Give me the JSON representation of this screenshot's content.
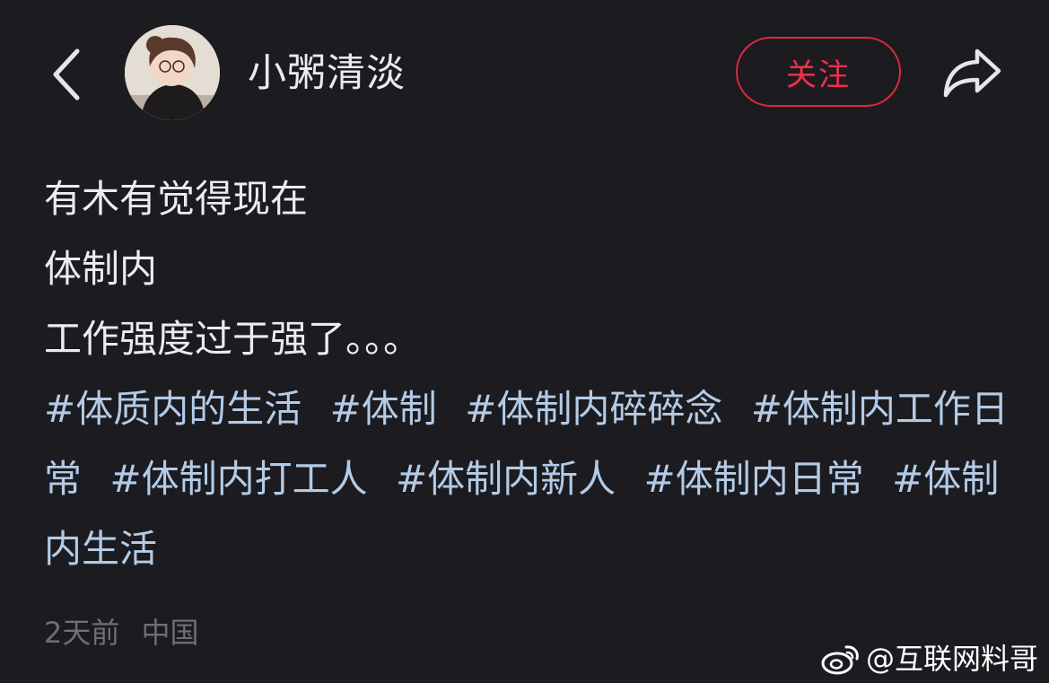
{
  "header": {
    "username": "小粥清淡",
    "follow_label": "关注",
    "icons": {
      "back": "chevron-left-icon",
      "share": "share-arrow-icon",
      "avatar": "user-avatar"
    },
    "accent_color": "#e0283e"
  },
  "post": {
    "lines": [
      "有木有觉得现在",
      "体制内",
      "工作强度过于强了。。。"
    ],
    "tags": [
      "#体质内的生活",
      "#体制",
      "#体制内碎碎念",
      "#体制内工作日常",
      "#体制内打工人",
      "#体制内新人",
      "#体制内日常",
      "#体制内生活"
    ],
    "tag_color": "#b3cbe6"
  },
  "meta": {
    "time": "2天前",
    "location": "中国"
  },
  "watermark": {
    "text": "@互联网料哥",
    "icon": "weibo-logo-icon"
  }
}
